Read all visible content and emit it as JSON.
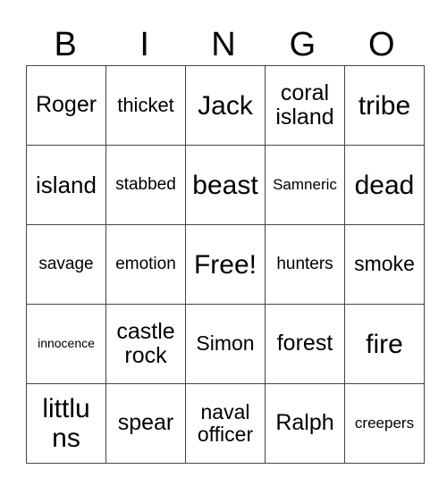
{
  "header": [
    "B",
    "I",
    "N",
    "G",
    "O"
  ],
  "rows": [
    [
      "Roger",
      "thicket",
      "Jack",
      "coral island",
      "tribe"
    ],
    [
      "island",
      "stabbed",
      "beast",
      "Samneric",
      "dead"
    ],
    [
      "savage",
      "emotion",
      "Free!",
      "hunters",
      "smoke"
    ],
    [
      "innocence",
      "castle rock",
      "Simon",
      "forest",
      "fire"
    ],
    [
      "littluns",
      "spear",
      "naval officer",
      "Ralph",
      "creepers"
    ]
  ],
  "display_rows": [
    [
      "Roger",
      "thicket",
      "Jack",
      "coral\nisland",
      "tribe"
    ],
    [
      "island",
      "stabbed",
      "beast",
      "Samneric",
      "dead"
    ],
    [
      "savage",
      "emotion",
      "Free!",
      "hunters",
      "smoke"
    ],
    [
      "innocence",
      "castle\nrock",
      "Simon",
      "forest",
      "fire"
    ],
    [
      "littlu\nns",
      "spear",
      "naval\nofficer",
      "Ralph",
      "creepers"
    ]
  ]
}
